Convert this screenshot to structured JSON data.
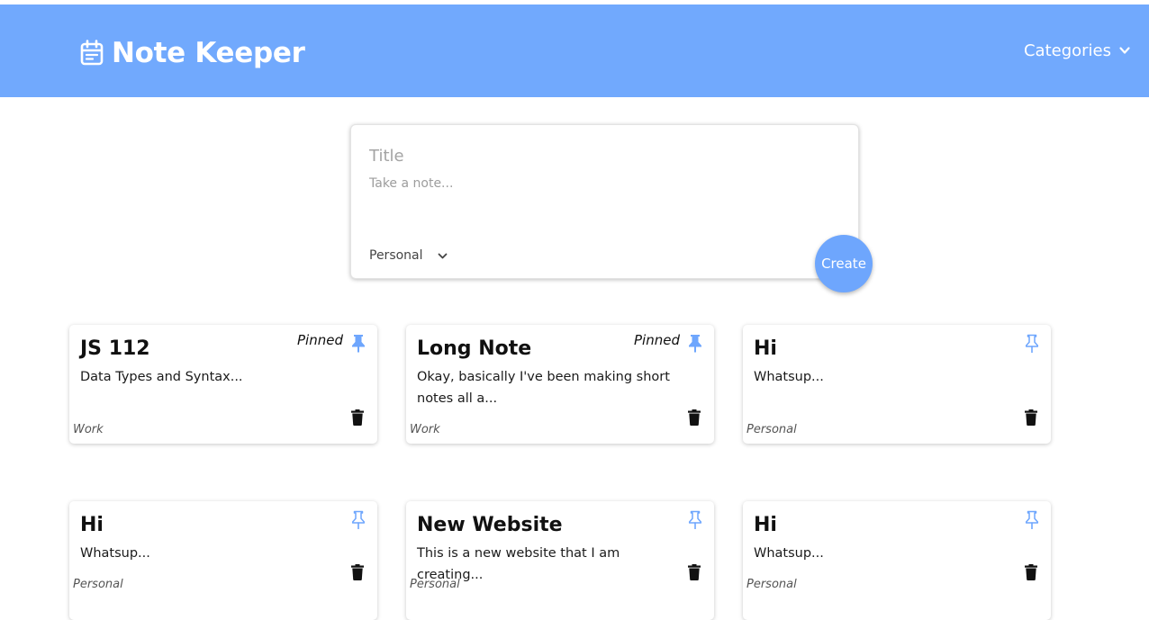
{
  "app": {
    "title": "Note Keeper",
    "accent": "#71a9fd",
    "icon": "calendar-note-icon"
  },
  "nav": {
    "categories_label": "Categories",
    "categories_icon": "chevron-down-icon"
  },
  "composer": {
    "title_placeholder": "Title",
    "title_value": "",
    "note_placeholder": "Take a note...",
    "note_value": "",
    "category_selected": "Personal",
    "create_label": "Create"
  },
  "notes": [
    {
      "title": "JS 112",
      "body": "Data Types and Syntax...",
      "category": "Work",
      "pinned": true,
      "pinned_label": "Pinned"
    },
    {
      "title": "Long Note",
      "body": "Okay, basically I've been making short notes all a...",
      "category": "Work",
      "pinned": true,
      "pinned_label": "Pinned"
    },
    {
      "title": "Hi",
      "body": "Whatsup...",
      "category": "Personal",
      "pinned": false,
      "pinned_label": ""
    },
    {
      "title": "Hi",
      "body": "Whatsup...",
      "category": "Personal",
      "pinned": false,
      "pinned_label": ""
    },
    {
      "title": "New Website",
      "body": "This is a new website that I am creating...",
      "category": "Personal",
      "pinned": false,
      "pinned_label": ""
    },
    {
      "title": "Hi",
      "body": "Whatsup...",
      "category": "Personal",
      "pinned": false,
      "pinned_label": ""
    }
  ]
}
